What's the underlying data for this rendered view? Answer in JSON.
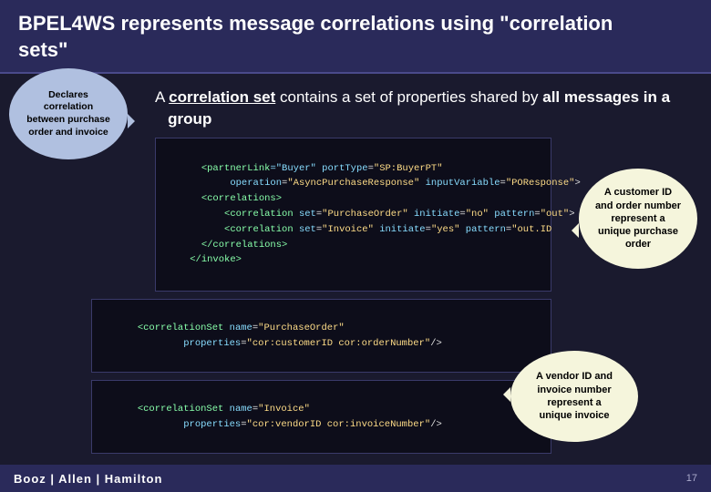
{
  "title": {
    "line1": "BPEL4WS represents message correlations using \"correlation",
    "line2": "sets\""
  },
  "subtitle": {
    "text": "A ",
    "bold_term": "correlation set",
    "rest": " contains a set of properties shared by ",
    "bold_all": "all messages in a",
    "group": " group"
  },
  "code_main": "    <partnerLink=\"Buyer\" portType=\"SP:BuyerPT\"\n         operation=\"AsyncPurchaseResponse\" inputVariable=\"POResponse\">\n    <correlations>\n        <correlation set=\"PurchaseOrder\" initiate=\"no\" pattern=\"out\">\n        <correlation set=\"Invoice\" initiate=\"yes\" pattern=\"out.ID\n    </correlations>\n</invoke>",
  "code_purchase_order": "<correlationSet name=\"PurchaseOrder\"\n        properties=\"cor:customerID cor:orderNumber\"/>",
  "code_invoice": "<correlationSet name=\"Invoice\"\n        properties=\"cor:vendorID cor:invoiceNumber\"/>",
  "bubble_declares": {
    "line1": "Declares",
    "line2": "correlation",
    "line3": "between purchase",
    "line4": "order and invoice"
  },
  "bubble_customer": {
    "line1": "A customer ID",
    "line2": "and order number",
    "line3": "represent a",
    "line4": "unique purchase",
    "line5": "order"
  },
  "bubble_vendor": {
    "line1": "A vendor ID and",
    "line2": "invoice number",
    "line3": "represent a",
    "line4": "unique invoice"
  },
  "bottom_bar": {
    "company": "Booz | Allen | Hamilton",
    "page": "17"
  }
}
